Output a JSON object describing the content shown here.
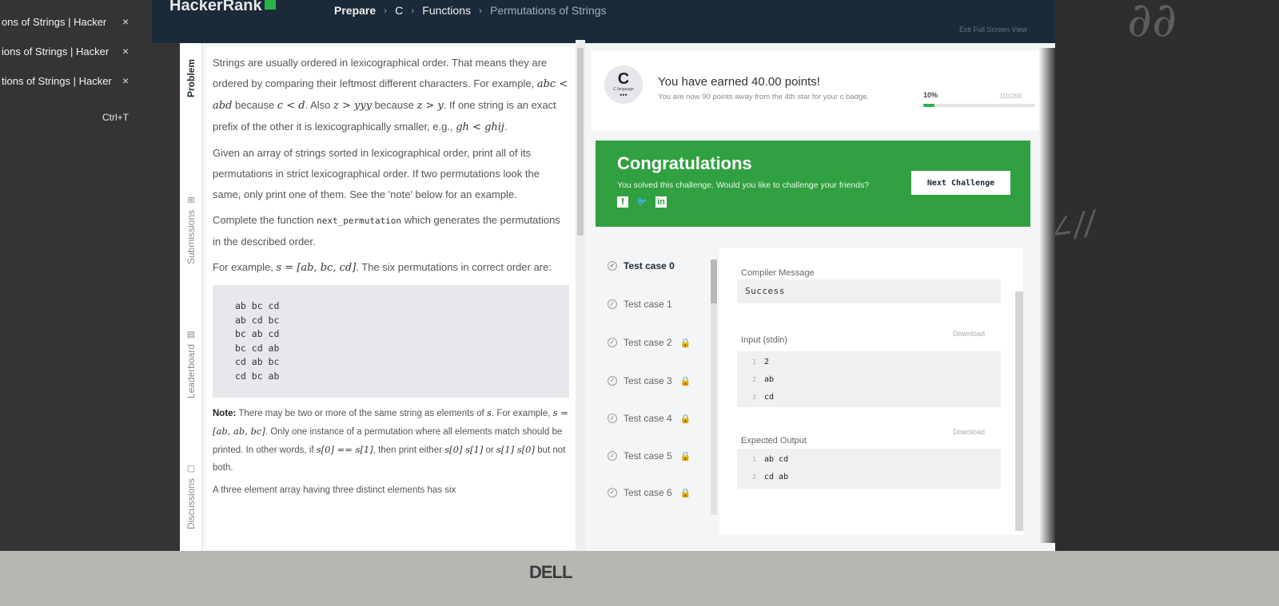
{
  "browser_tabs": [
    {
      "title": "ons of Strings | Hacker",
      "close": "×"
    },
    {
      "title": "ions of Strings | Hacker",
      "close": "×"
    },
    {
      "title": "tions of Strings | Hacker",
      "close": "×"
    }
  ],
  "shortcut": "Ctrl+T",
  "nav": {
    "brand": "HackerRank",
    "breadcrumbs": [
      "Prepare",
      "C",
      "Functions",
      "Permutations of Strings"
    ],
    "fullscreen_label": "Exit Full Screen View"
  },
  "side_tabs": [
    "Problem",
    "Submissions",
    "Leaderboard",
    "Discussions"
  ],
  "problem": {
    "p1_a": "Strings are usually ordered in lexicographical order. That means they are ordered by comparing their leftmost different characters. For example,",
    "m1": "abc < abd",
    "p1_b": "because",
    "m2": "c < d",
    "p1_c": ". Also",
    "m3": "z > yyy",
    "p1_d": "because",
    "m4": "z > y",
    "p1_e": ". If one string is an exact prefix of the other it is lexicographically smaller, e.g.,",
    "m5": "gh < ghij",
    "p2": "Given an array of strings sorted in lexicographical order, print all of its permutations in strict lexicographical order. If two permutations look the same, only print one of them. See the 'note' below for an example.",
    "p3_a": "Complete the function",
    "p3_code": "next_permutation",
    "p3_b": "which generates the permutations in the described order.",
    "p4_a": "For example,",
    "m6": "s = [ab, bc, cd]",
    "p4_b": ". The six permutations in correct order are:",
    "code_lines": [
      "ab bc cd",
      "ab cd bc",
      "bc ab cd",
      "bc cd ab",
      "cd ab bc",
      "cd bc ab"
    ],
    "note_label": "Note:",
    "note_a": "There may be two or more of the same string as elements of",
    "m7": "s",
    "note_b": ". For example,",
    "m8": "s = [ab, ab, bc]",
    "note_c": ". Only one instance of a permutation where all elements match should be printed. In other words, if",
    "m9": "s[0] == s[1]",
    "note_d": ", then print either",
    "m10": "s[0] s[1]",
    "note_or": "or",
    "m11": "s[1] s[0]",
    "note_e": "but not both.",
    "p5": "A three element array having three distinct elements has six"
  },
  "score": {
    "badge_letter": "C",
    "badge_label": "C language",
    "badge_dots": "•••",
    "earned": "You have earned 40.00 points!",
    "away": "You are now 90 points away from the 4th star for your c badge.",
    "percent": "10%",
    "progress": 0.1,
    "points": "110/200"
  },
  "congrats": {
    "title": "Congratulations",
    "message": "You solved this challenge. Would you like to challenge your friends?",
    "next_button": "Next Challenge",
    "social": [
      "f",
      "t",
      "in"
    ]
  },
  "test_cases": [
    {
      "label": "Test case 0",
      "locked": false
    },
    {
      "label": "Test case 1",
      "locked": false
    },
    {
      "label": "Test case 2",
      "locked": true
    },
    {
      "label": "Test case 3",
      "locked": true
    },
    {
      "label": "Test case 4",
      "locked": true
    },
    {
      "label": "Test case 5",
      "locked": true
    },
    {
      "label": "Test case 6",
      "locked": true
    }
  ],
  "output": {
    "compiler_label": "Compiler Message",
    "compiler_value": "Success",
    "input_label": "Input (stdin)",
    "download_label": "Download",
    "input_lines": [
      "2",
      "ab",
      "cd"
    ],
    "expected_label": "Expected Output",
    "expected_lines": [
      "ab cd",
      "cd ab"
    ]
  },
  "laptop_logo": "DELL",
  "colors": {
    "nav_bg": "#1b2a38",
    "brand_green": "#29b44a",
    "congrats_green": "#31a040"
  }
}
